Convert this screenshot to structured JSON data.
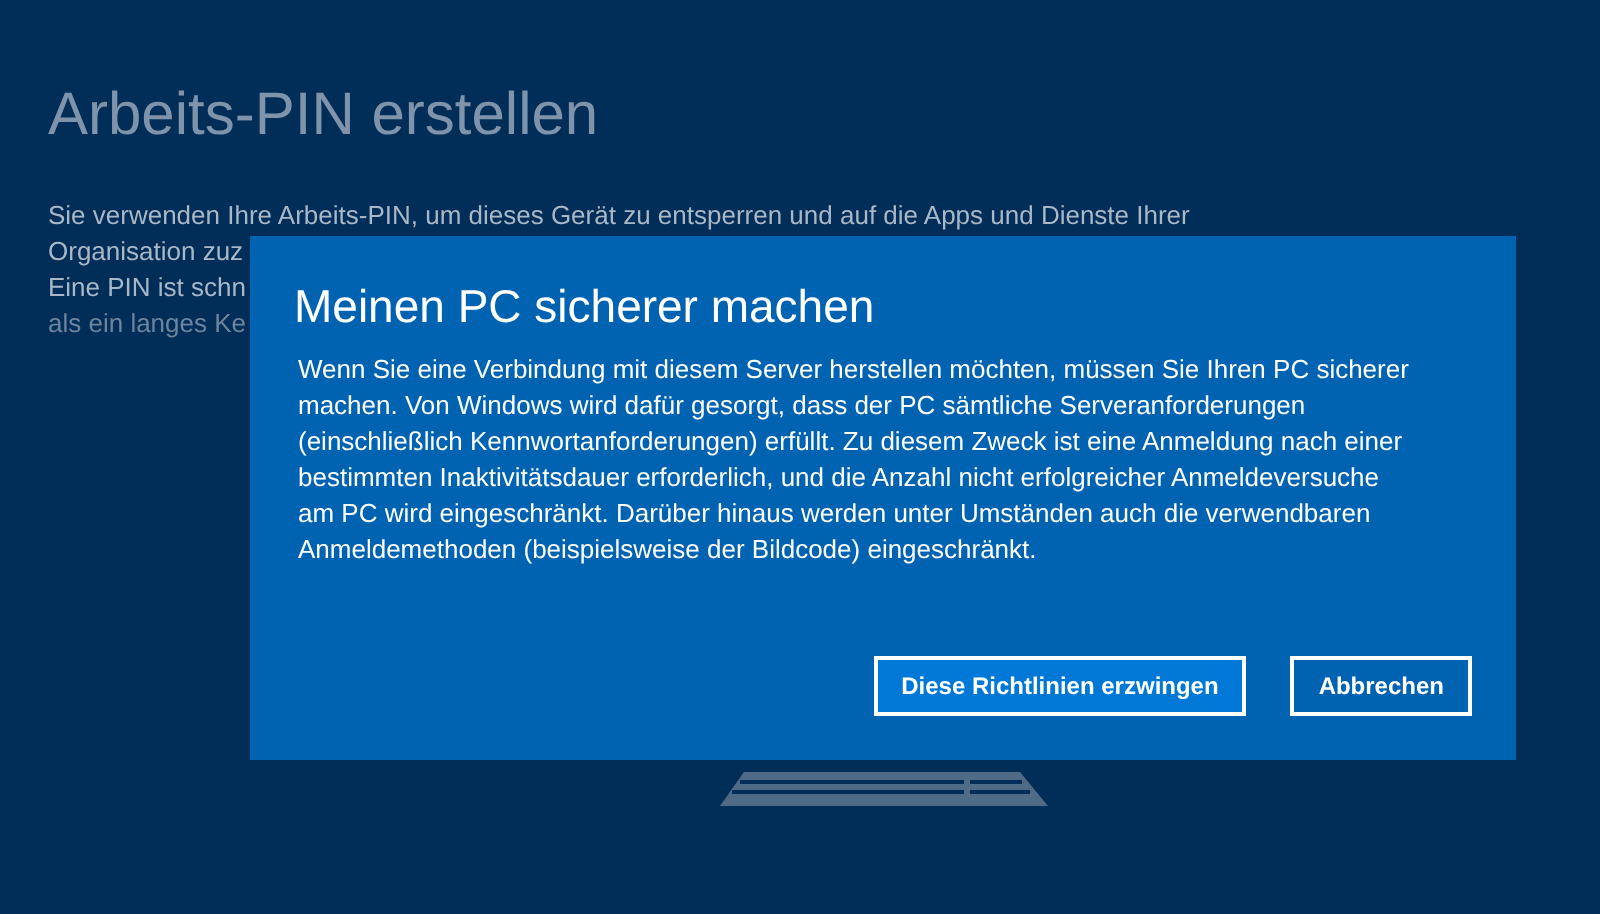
{
  "page": {
    "title": "Arbeits-PIN erstellen",
    "lines": [
      {
        "text": "Sie verwenden Ihre Arbeits-PIN, um dieses Gerät zu entsperren und auf die Apps und Dienste Ihrer",
        "dimmed": false
      },
      {
        "text": "Organisation zuz",
        "dimmed": false
      },
      {
        "text": "Eine PIN ist schn",
        "dimmed": false
      },
      {
        "text": "als ein langes Ke",
        "dimmed": true
      }
    ]
  },
  "dialog": {
    "title": "Meinen PC sicherer machen",
    "message": "Wenn Sie eine Verbindung mit diesem Server herstellen möchten, müssen Sie Ihren PC sicherer machen. Von Windows wird dafür gesorgt, dass der PC sämtliche Serveranforderungen (einschließlich Kennwortanforderungen) erfüllt. Zu diesem Zweck ist eine Anmeldung nach einer bestimmten Inaktivitätsdauer erforderlich, und die Anzahl nicht erfolgreicher Anmeldeversuche am PC wird eingeschränkt. Darüber hinaus werden unter Umständen auch die verwendbaren Anmeldemethoden (beispielsweise der Bildcode) eingeschränkt.",
    "buttons": [
      {
        "label": "Diese Richtlinien erzwingen",
        "kind": "primary"
      },
      {
        "label": "Abbrechen",
        "kind": "secondary"
      }
    ]
  }
}
